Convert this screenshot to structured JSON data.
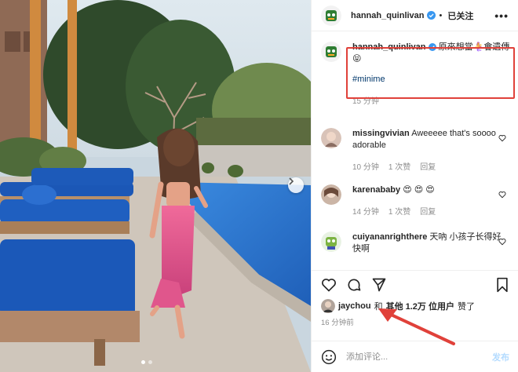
{
  "header": {
    "username": "hannah_quinlivan",
    "separator": "•",
    "follow_label": "已关注",
    "more_icon": "more-dots-icon"
  },
  "caption": {
    "username": "hannah_quinlivan",
    "text": "原來想當🧜‍♀️會遺傳😝",
    "hashtag": "#minime",
    "time": "15 分钟"
  },
  "comments": [
    {
      "username": "missingvivian",
      "text": "Aweeeee that's soooo adorable",
      "time": "10 分钟",
      "likes": "1 次赞",
      "reply": "回复"
    },
    {
      "username": "karenababy",
      "text": "😍 😍 😍",
      "time": "14 分钟",
      "likes": "1 次赞",
      "reply": "回复"
    },
    {
      "username": "cuiyananrighthere",
      "text": "天吶 小孩子长得好快啊",
      "time": "",
      "likes": "",
      "reply": ""
    }
  ],
  "actions": {
    "icons": [
      "heart-icon",
      "comment-icon",
      "share-icon",
      "bookmark-icon"
    ],
    "liked_by_user": "jaychou",
    "liked_by_mid": "和",
    "liked_by_others": "其他 1.2万 位用户",
    "liked_by_suffix": "赞了",
    "time_ago": "16 分钟前"
  },
  "add_comment": {
    "placeholder": "添加评论...",
    "post_label": "发布",
    "emoji_icon": "smiley-icon"
  },
  "colors": {
    "verified_blue": "#3897f0",
    "highlight_red": "#e0413a",
    "pool_blue": "#2f7ed8",
    "lounger_blue": "#1b57b6"
  }
}
